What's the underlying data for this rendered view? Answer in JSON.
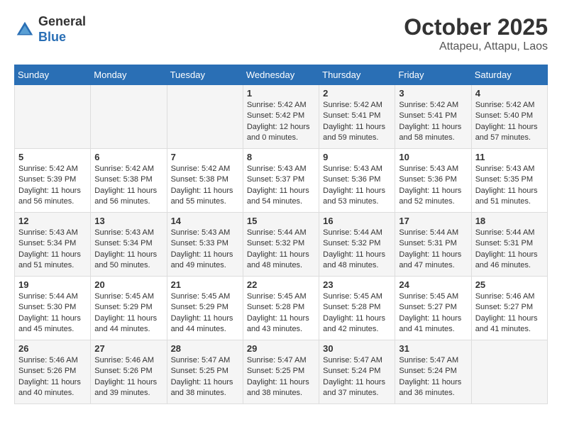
{
  "logo": {
    "general": "General",
    "blue": "Blue"
  },
  "title": "October 2025",
  "subtitle": "Attapeu, Attapu, Laos",
  "days_of_week": [
    "Sunday",
    "Monday",
    "Tuesday",
    "Wednesday",
    "Thursday",
    "Friday",
    "Saturday"
  ],
  "weeks": [
    [
      {
        "day": "",
        "info": ""
      },
      {
        "day": "",
        "info": ""
      },
      {
        "day": "",
        "info": ""
      },
      {
        "day": "1",
        "info": "Sunrise: 5:42 AM\nSunset: 5:42 PM\nDaylight: 12 hours and 0 minutes."
      },
      {
        "day": "2",
        "info": "Sunrise: 5:42 AM\nSunset: 5:41 PM\nDaylight: 11 hours and 59 minutes."
      },
      {
        "day": "3",
        "info": "Sunrise: 5:42 AM\nSunset: 5:41 PM\nDaylight: 11 hours and 58 minutes."
      },
      {
        "day": "4",
        "info": "Sunrise: 5:42 AM\nSunset: 5:40 PM\nDaylight: 11 hours and 57 minutes."
      }
    ],
    [
      {
        "day": "5",
        "info": "Sunrise: 5:42 AM\nSunset: 5:39 PM\nDaylight: 11 hours and 56 minutes."
      },
      {
        "day": "6",
        "info": "Sunrise: 5:42 AM\nSunset: 5:38 PM\nDaylight: 11 hours and 56 minutes."
      },
      {
        "day": "7",
        "info": "Sunrise: 5:42 AM\nSunset: 5:38 PM\nDaylight: 11 hours and 55 minutes."
      },
      {
        "day": "8",
        "info": "Sunrise: 5:43 AM\nSunset: 5:37 PM\nDaylight: 11 hours and 54 minutes."
      },
      {
        "day": "9",
        "info": "Sunrise: 5:43 AM\nSunset: 5:36 PM\nDaylight: 11 hours and 53 minutes."
      },
      {
        "day": "10",
        "info": "Sunrise: 5:43 AM\nSunset: 5:36 PM\nDaylight: 11 hours and 52 minutes."
      },
      {
        "day": "11",
        "info": "Sunrise: 5:43 AM\nSunset: 5:35 PM\nDaylight: 11 hours and 51 minutes."
      }
    ],
    [
      {
        "day": "12",
        "info": "Sunrise: 5:43 AM\nSunset: 5:34 PM\nDaylight: 11 hours and 51 minutes."
      },
      {
        "day": "13",
        "info": "Sunrise: 5:43 AM\nSunset: 5:34 PM\nDaylight: 11 hours and 50 minutes."
      },
      {
        "day": "14",
        "info": "Sunrise: 5:43 AM\nSunset: 5:33 PM\nDaylight: 11 hours and 49 minutes."
      },
      {
        "day": "15",
        "info": "Sunrise: 5:44 AM\nSunset: 5:32 PM\nDaylight: 11 hours and 48 minutes."
      },
      {
        "day": "16",
        "info": "Sunrise: 5:44 AM\nSunset: 5:32 PM\nDaylight: 11 hours and 48 minutes."
      },
      {
        "day": "17",
        "info": "Sunrise: 5:44 AM\nSunset: 5:31 PM\nDaylight: 11 hours and 47 minutes."
      },
      {
        "day": "18",
        "info": "Sunrise: 5:44 AM\nSunset: 5:31 PM\nDaylight: 11 hours and 46 minutes."
      }
    ],
    [
      {
        "day": "19",
        "info": "Sunrise: 5:44 AM\nSunset: 5:30 PM\nDaylight: 11 hours and 45 minutes."
      },
      {
        "day": "20",
        "info": "Sunrise: 5:45 AM\nSunset: 5:29 PM\nDaylight: 11 hours and 44 minutes."
      },
      {
        "day": "21",
        "info": "Sunrise: 5:45 AM\nSunset: 5:29 PM\nDaylight: 11 hours and 44 minutes."
      },
      {
        "day": "22",
        "info": "Sunrise: 5:45 AM\nSunset: 5:28 PM\nDaylight: 11 hours and 43 minutes."
      },
      {
        "day": "23",
        "info": "Sunrise: 5:45 AM\nSunset: 5:28 PM\nDaylight: 11 hours and 42 minutes."
      },
      {
        "day": "24",
        "info": "Sunrise: 5:45 AM\nSunset: 5:27 PM\nDaylight: 11 hours and 41 minutes."
      },
      {
        "day": "25",
        "info": "Sunrise: 5:46 AM\nSunset: 5:27 PM\nDaylight: 11 hours and 41 minutes."
      }
    ],
    [
      {
        "day": "26",
        "info": "Sunrise: 5:46 AM\nSunset: 5:26 PM\nDaylight: 11 hours and 40 minutes."
      },
      {
        "day": "27",
        "info": "Sunrise: 5:46 AM\nSunset: 5:26 PM\nDaylight: 11 hours and 39 minutes."
      },
      {
        "day": "28",
        "info": "Sunrise: 5:47 AM\nSunset: 5:25 PM\nDaylight: 11 hours and 38 minutes."
      },
      {
        "day": "29",
        "info": "Sunrise: 5:47 AM\nSunset: 5:25 PM\nDaylight: 11 hours and 38 minutes."
      },
      {
        "day": "30",
        "info": "Sunrise: 5:47 AM\nSunset: 5:24 PM\nDaylight: 11 hours and 37 minutes."
      },
      {
        "day": "31",
        "info": "Sunrise: 5:47 AM\nSunset: 5:24 PM\nDaylight: 11 hours and 36 minutes."
      },
      {
        "day": "",
        "info": ""
      }
    ]
  ]
}
